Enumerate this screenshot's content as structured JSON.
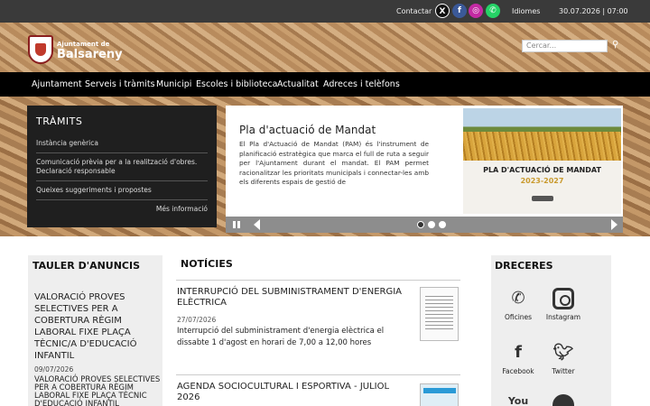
{
  "topbar": {
    "contact": "Contactar",
    "social": [
      "X",
      "f",
      "ig",
      "wa"
    ],
    "languages": "Idiomes",
    "datetime": "30.07.2026 | 07:00"
  },
  "header": {
    "logo_small": "Ajuntament de",
    "logo_big": "Balsareny",
    "search_placeholder": "Cercar..."
  },
  "nav": {
    "items": [
      "Ajuntament",
      "Serveis i tràmits",
      "Municipi",
      "Escoles i biblioteca",
      "Actualitat",
      "Adreces i telèfons"
    ]
  },
  "tramits": {
    "title": "TRÀMITS",
    "items": [
      "Instància genèrica",
      "Comunicació prèvia per a la realització d'obres. Declaració responsable",
      "Queixes suggeriments i propostes"
    ],
    "more": "Més informació"
  },
  "slider": {
    "title": "Pla d'actuació de Mandat",
    "text": "El Pla d'Actuació de Mandat (PAM) és l'instrument de planificació estratègica que marca el full de ruta a seguir per l'Ajuntament durant el mandat. El PAM permet racionalitzar les prioritats municipals i connectar-les amb els diferents espais de gestió de",
    "image_title": "PLA D'ACTUACIÓ DE MANDAT",
    "image_years": "2023-2027",
    "active_slide": 1,
    "slide_count": 3
  },
  "tauler": {
    "title": "TAULER D'ANUNCIS",
    "headline": "VALORACIÓ PROVES SELECTIVES PER A COBERTURA RÈGIM LABORAL FIXE PLAÇA TÈCNIC/A D'EDUCACIÓ INFANTIL",
    "date": "09/07/2026",
    "body": "VALORACIÓ PROVES SELECTIVES PER A COBERTURA RÈGIM LABORAL FIXE PLAÇA TÈCNIC D'EDUCACIÓ INFANTIL"
  },
  "noticies": {
    "title": "NOTÍCIES",
    "items": [
      {
        "title": "INTERRUPCIÓ DEL SUBMINISTRAMENT D'ENERGIA ELÈCTRICA",
        "date": "27/07/2026",
        "desc": "Interrupció del subministrament d'energia elèctrica el dissabte 1 d'agost en horari de 7,00 a 12,00 hores"
      },
      {
        "title": "AGENDA SOCIOCULTURAL I ESPORTIVA - JULIOL 2026",
        "date": "",
        "desc": ""
      }
    ]
  },
  "dreceres": {
    "title": "DRECERES",
    "items": [
      {
        "label": "Oficines",
        "icon": "phone-icon"
      },
      {
        "label": "Instagram",
        "icon": "instagram-icon"
      },
      {
        "label": "Facebook",
        "icon": "facebook-icon"
      },
      {
        "label": "Twitter",
        "icon": "twitter-icon"
      },
      {
        "label": "",
        "icon": "youtube-icon"
      },
      {
        "label": "",
        "icon": "other-icon"
      }
    ]
  },
  "colors": {
    "topbar": "#3a3a3a",
    "nav": "#000000",
    "panel": "#1f1f1f",
    "accent_gold": "#c99a2e"
  }
}
